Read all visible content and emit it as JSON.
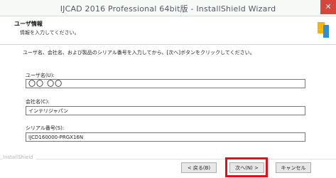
{
  "window": {
    "title": "IJCAD 2016 Professional 64bit版 - InstallShield Wizard",
    "close_glyph": "✕"
  },
  "header": {
    "title": "ユーザ情報",
    "subtitle": "情報を入力してください。",
    "logo_icon": "installshield-logo-icon"
  },
  "instruction": "ユーザ名、会社名、および製品のシリアル番号を入力してから、[次へ]ボタンをクリックしてください。",
  "fields": {
    "user_name": {
      "label": "ユーザ名(U):",
      "value": "〇〇 〇〇"
    },
    "company_name": {
      "label": "会社名(C):",
      "value": "インテリジャパン"
    },
    "serial": {
      "label": "シリアル番号(S):",
      "value": "IJCD160000-PRGX16N"
    }
  },
  "footer": {
    "brand": "InstallShield",
    "back_label": "< 戻る(B)",
    "next_label": "次へ(N) >",
    "cancel_label": "キャンセル"
  },
  "colors": {
    "highlight": "#e0101a",
    "close_button": "#d8453a"
  }
}
